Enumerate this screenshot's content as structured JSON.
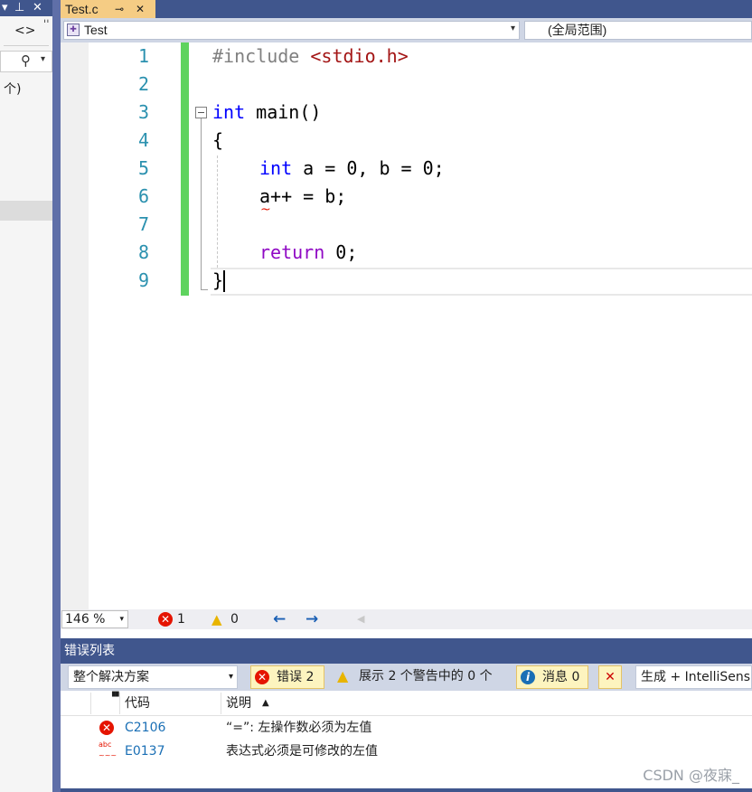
{
  "left_panel": {
    "pin_glyph": "▾ 푸 ✕",
    "code_toggle": "<>",
    "search_glyph": "⚲ ▾",
    "count_suffix": "个)"
  },
  "tab": {
    "title": "Test.c",
    "pin": "⊸",
    "close": "✕"
  },
  "nav": {
    "project": "Test",
    "scope": "(全局范围)"
  },
  "editor": {
    "line_numbers": [
      "1",
      "2",
      "3",
      "4",
      "5",
      "6",
      "7",
      "8",
      "9"
    ],
    "lines": {
      "l1_pp": "#include ",
      "l1_str": "<stdio.h>",
      "l3_kw": "int",
      "l3_rest": " main()",
      "l4": "{",
      "l5_kw": "int",
      "l5_rest": " a = 0, b = 0;",
      "l6": "a++ = b;",
      "l8_kw": "return",
      "l8_rest": " 0;",
      "l9": "}"
    },
    "squiggle": "~"
  },
  "status": {
    "zoom": "146 %",
    "error_count": "1",
    "warning_count": "0",
    "nav_back": "←",
    "nav_fwd": "→"
  },
  "error_list": {
    "title": "错误列表",
    "scope_select": "整个解决方案",
    "errors_btn": "错误 2",
    "warnings_btn": "展示 2 个警告中的 0 个",
    "messages_btn": "消息 0",
    "build_filter": "生成 + IntelliSens",
    "columns": {
      "code": "代码",
      "description": "说明"
    },
    "rows": [
      {
        "code": "C2106",
        "description": "“=”: 左操作数必须为左值",
        "icon": "error-icon"
      },
      {
        "code": "E0137",
        "description": "表达式必须是可修改的左值",
        "icon": "intellisense-error-icon"
      }
    ]
  },
  "watermark": "CSDN @夜寐_",
  "colors": {
    "accent_blue": "#40568d",
    "tab_active": "#f5cc84",
    "keyword": "#0000ff",
    "string": "#a31515",
    "control_keyword": "#8f08c4",
    "line_number": "#2b91af",
    "changed_bar": "#5fd35f",
    "error_red": "#e51400"
  }
}
